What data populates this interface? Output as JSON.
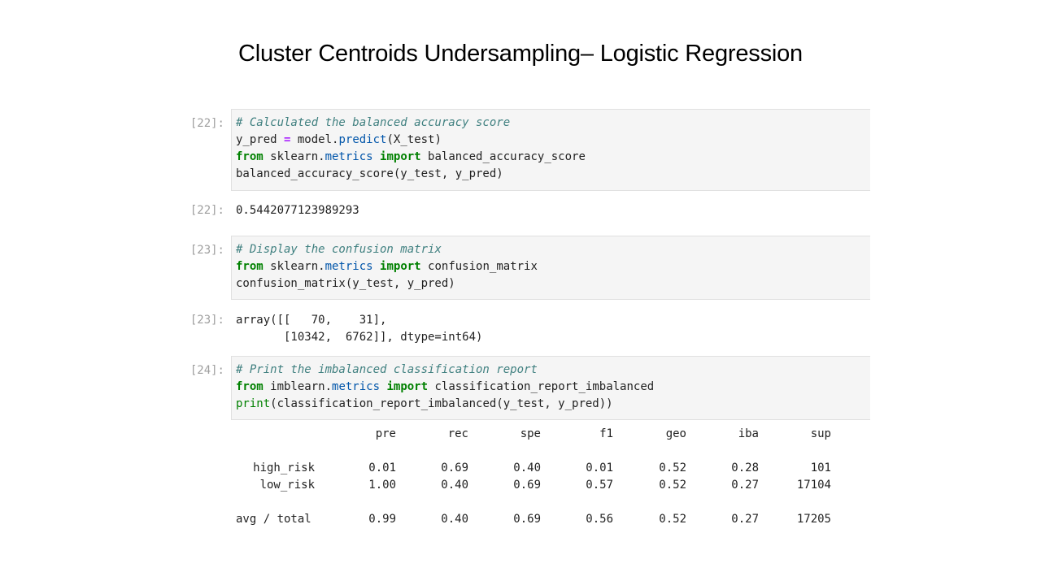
{
  "slide": {
    "title": "Cluster Centroids Undersampling– Logistic Regression"
  },
  "cells": {
    "c22": {
      "in_prompt": "[22]:",
      "out_prompt": "[22]:",
      "line1_comment": "# Calculated the balanced accuracy score",
      "line2_a": "y_pred ",
      "line2_op": "=",
      "line2_b": " model.",
      "line2_attr": "predict",
      "line2_c": "(X_test)",
      "line3_kw1": "from",
      "line3_a": " sklearn.",
      "line3_attr": "metrics",
      "line3_b": " ",
      "line3_kw2": "import",
      "line3_c": " balanced_accuracy_score",
      "line4": "balanced_accuracy_score(y_test, y_pred)",
      "output": "0.5442077123989293"
    },
    "c23": {
      "in_prompt": "[23]:",
      "out_prompt": "[23]:",
      "line1_comment": "# Display the confusion matrix",
      "line2_kw1": "from",
      "line2_a": " sklearn.",
      "line2_attr": "metrics",
      "line2_b": " ",
      "line2_kw2": "import",
      "line2_c": " confusion_matrix",
      "line3": "confusion_matrix(y_test, y_pred)",
      "output_line1": "array([[   70,    31],",
      "output_line2": "       [10342,  6762]], dtype=int64)"
    },
    "c24": {
      "in_prompt": "[24]:",
      "line1_comment": "# Print the imbalanced classification report",
      "line2_kw1": "from",
      "line2_a": " imblearn.",
      "line2_attr": "metrics",
      "line2_b": " ",
      "line2_kw2": "import",
      "line2_c": " classification_report_imbalanced",
      "line3_builtin": "print",
      "line3_rest": "(classification_report_imbalanced(y_test, y_pred))"
    }
  },
  "report": {
    "headers": [
      "pre",
      "rec",
      "spe",
      "f1",
      "geo",
      "iba",
      "sup"
    ],
    "rows": [
      {
        "label": "high_risk",
        "values": [
          "0.01",
          "0.69",
          "0.40",
          "0.01",
          "0.52",
          "0.28",
          "101"
        ]
      },
      {
        "label": "low_risk",
        "values": [
          "1.00",
          "0.40",
          "0.69",
          "0.57",
          "0.52",
          "0.27",
          "17104"
        ]
      }
    ],
    "total": {
      "label": "avg / total",
      "values": [
        "0.99",
        "0.40",
        "0.69",
        "0.56",
        "0.52",
        "0.27",
        "17205"
      ]
    }
  }
}
